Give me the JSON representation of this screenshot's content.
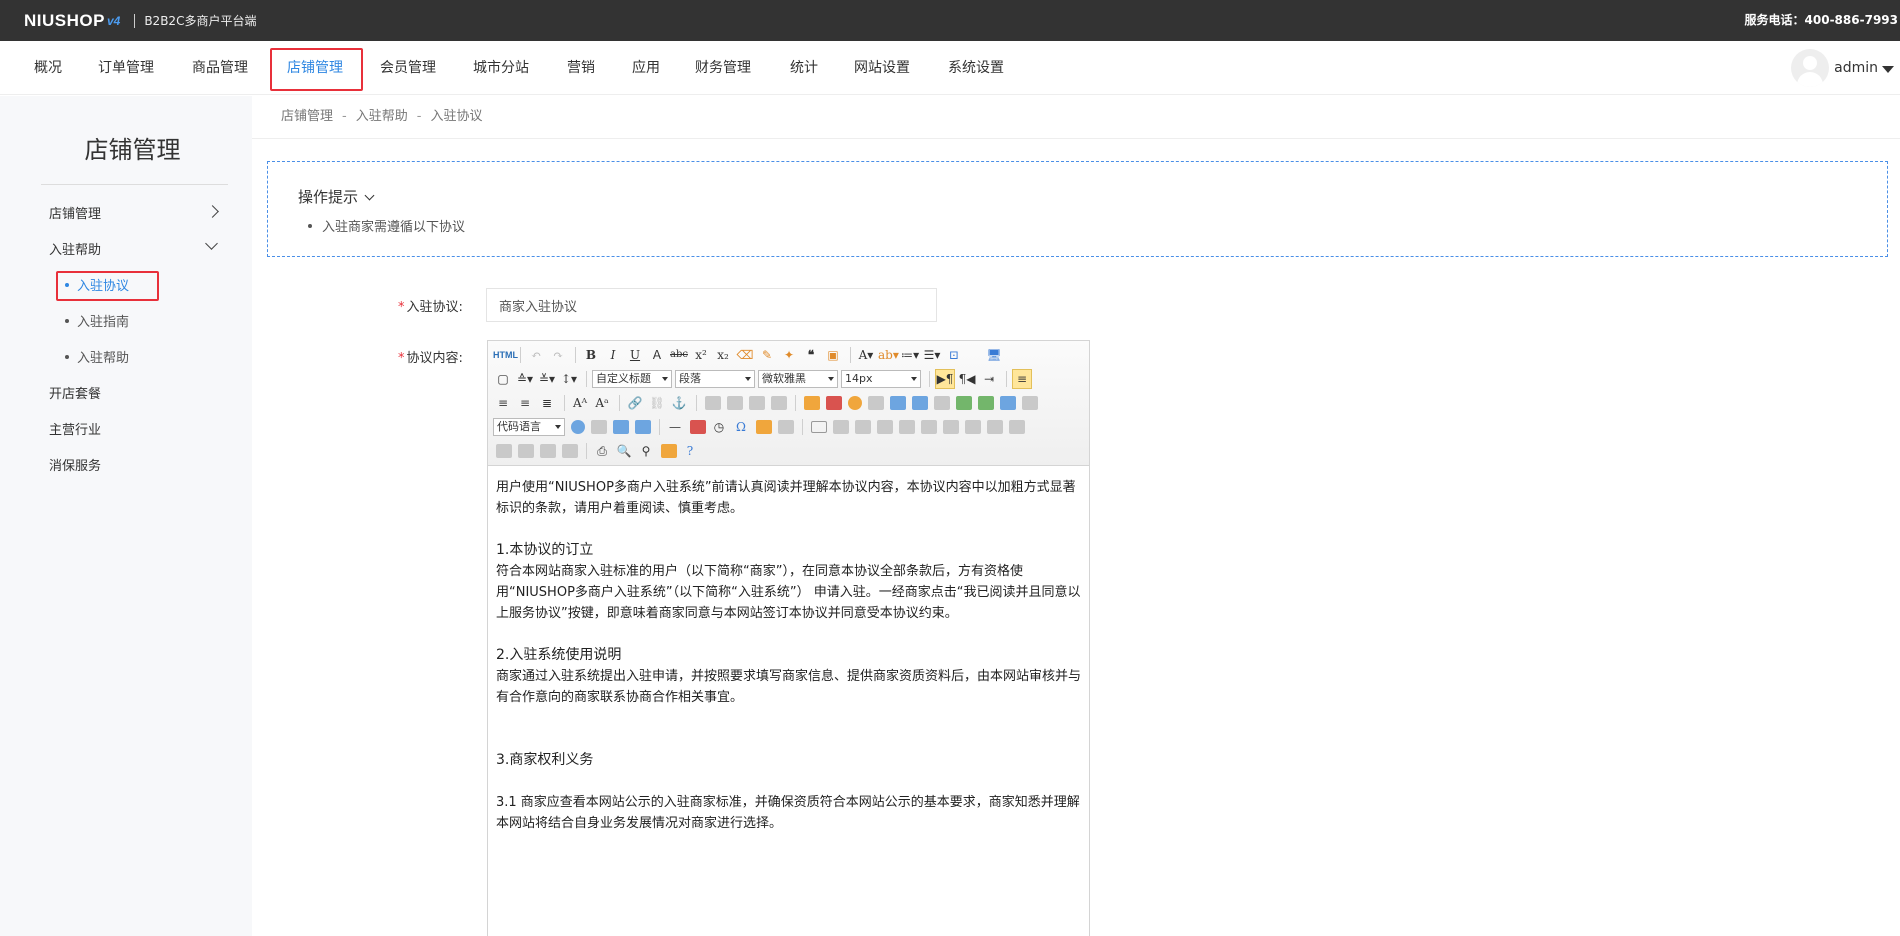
{
  "topbar": {
    "logo_text": "NIUSHOP",
    "logo_version": "v4",
    "logo_subtitle": "B2B2C多商户平台端",
    "hotline": "服务电话：400-886-7993"
  },
  "nav": {
    "items": [
      "概况",
      "订单管理",
      "商品管理",
      "店铺管理",
      "会员管理",
      "城市分站",
      "营销",
      "应用",
      "财务管理",
      "统计",
      "网站设置",
      "系统设置"
    ],
    "active_index": 3,
    "username": "admin"
  },
  "sidebar": {
    "title": "店铺管理",
    "items": [
      {
        "label": "店铺管理"
      },
      {
        "label": "入驻帮助"
      },
      {
        "label": "开店套餐"
      },
      {
        "label": "主营行业"
      },
      {
        "label": "消保服务"
      }
    ],
    "sub_items": [
      {
        "label": "入驻协议"
      },
      {
        "label": "入驻指南"
      },
      {
        "label": "入驻帮助"
      }
    ]
  },
  "breadcrumb": [
    "店铺管理",
    "入驻帮助",
    "入驻协议"
  ],
  "breadcrumb_sep": "-",
  "tips": {
    "title": "操作提示",
    "items": [
      "入驻商家需遵循以下协议"
    ]
  },
  "form": {
    "title_label": "入驻协议:",
    "title_value": "商家入驻协议",
    "content_label": "协议内容:",
    "required_mark": "*"
  },
  "editor": {
    "selects": {
      "heading": "自定义标题",
      "paragraph": "段落",
      "font": "微软雅黑",
      "size": "14px",
      "code_lang": "代码语言"
    },
    "content": {
      "p1": "用户使用“NIUSHOP多商户入驻系统”前请认真阅读并理解本协议内容，本协议内容中以加粗方式显著标识的条款，请用户着重阅读、慎重考虑。",
      "h1": "1.本协议的订立",
      "p2": "符合本网站商家入驻标准的用户（以下简称“商家”），在同意本协议全部条款后，方有资格使用“NIUSHOP多商户入驻系统”（以下简称“入驻系统”） 申请入驻。一经商家点击“我已阅读并且同意以上服务协议”按键，即意味着商家同意与本网站签订本协议并同意受本协议约束。",
      "h2": "2.入驻系统使用说明",
      "p3": "商家通过入驻系统提出入驻申请，并按照要求填写商家信息、提供商家资质资料后，由本网站审核并与有合作意向的商家联系协商合作相关事宜。",
      "h3": "3.商家权利义务",
      "p4": "3.1 商家应查看本网站公示的入驻商家标准，并确保资质符合本网站公示的基本要求，商家知悉并理解本网站将结合自身业务发展情况对商家进行选择。"
    }
  }
}
